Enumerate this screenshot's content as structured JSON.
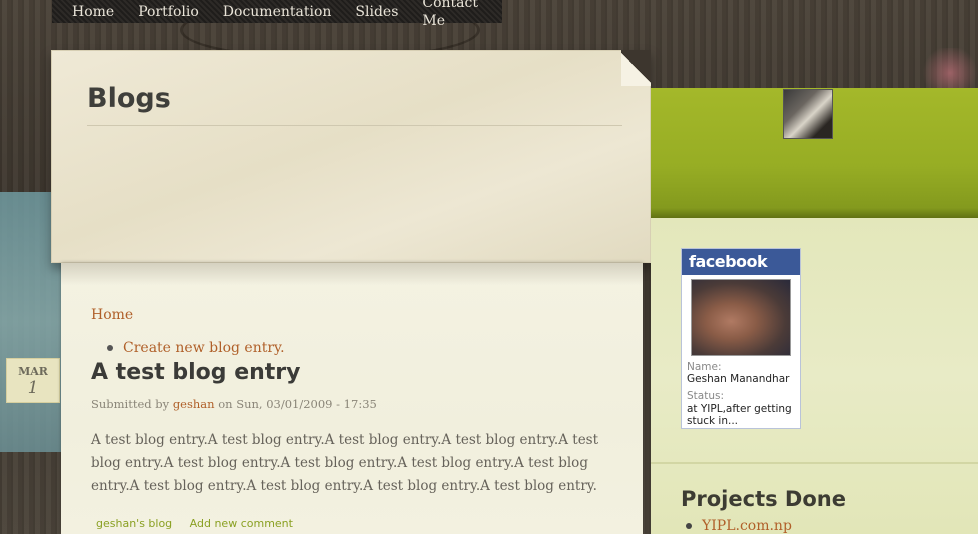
{
  "nav": {
    "items": [
      {
        "label": "Home"
      },
      {
        "label": "Portfolio"
      },
      {
        "label": "Documentation"
      },
      {
        "label": "Slides"
      },
      {
        "label": "Contact Me"
      }
    ]
  },
  "header": {
    "title": "Blogs"
  },
  "content": {
    "breadcrumb": "Home",
    "tabs": [
      {
        "label": "Create new blog entry."
      }
    ],
    "post": {
      "date_month": "MAR",
      "date_day": "1",
      "title": "A test blog entry",
      "submitted_prefix": "Submitted by",
      "author": "geshan",
      "submitted_suffix": "on Sun, 03/01/2009 - 17:35",
      "body": "A test blog entry.A test blog entry.A test blog entry.A test blog entry.A test blog entry.A test blog entry.A test blog entry.A test blog entry.A test blog entry.A test blog entry.A test blog entry.A test blog entry.A test blog entry.",
      "links": [
        {
          "label": "geshan's blog"
        },
        {
          "label": "Add new comment"
        }
      ]
    }
  },
  "sidebar": {
    "facebook": {
      "brand": "facebook",
      "name_label": "Name:",
      "name_value": "Geshan Manandhar",
      "status_label": "Status:",
      "status_value": "at YIPL,after getting stuck in..."
    },
    "projects": {
      "title": "Projects Done",
      "items": [
        {
          "label": "YIPL.com.np"
        }
      ]
    }
  },
  "colors": {
    "link": "#b0602a",
    "accent_green": "#a4b82a",
    "facebook_blue": "#3b5998",
    "nav_bg": "#2d2a27"
  },
  "icons": {
    "bullet": "bullet-icon",
    "avatar": "avatar"
  }
}
